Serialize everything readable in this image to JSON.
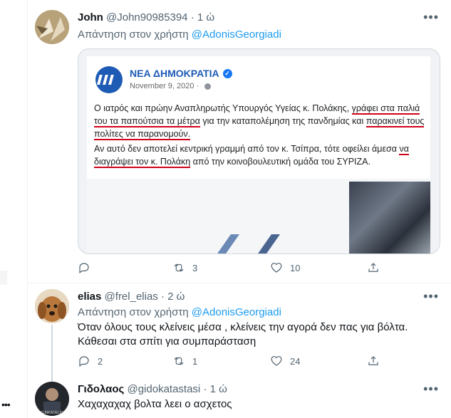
{
  "tweets": [
    {
      "name": "John",
      "handle": "@John90985394",
      "time": "· 1 ώ",
      "reply_prefix": "Απάντηση στον χρήστη",
      "reply_to": "@AdonisGeorgiadi",
      "embed": {
        "page_name": "ΝΕΑ ΔΗΜΟΚΡΑΤΙΑ",
        "date": "November 9, 2020 ·",
        "paragraph1_a": "Ο ιατρός και πρώην Αναπληρωτής Υπουργός Υγείας κ. Πολάκης, ",
        "paragraph1_u1": "γράφει στα παλιά του τα παπούτσια τα μέτρα",
        "paragraph1_b": " για την καταπολέμηση της πανδημίας και ",
        "paragraph1_u2": "παρακινεί τους πολίτες να παρανομούν.",
        "paragraph2_a": "Αν αυτό δεν αποτελεί κεντρική γραμμή από τον κ. Τσίπρα, τότε οφείλει άμεσα ",
        "paragraph2_u": "να διαγράψει τον κ. Πολάκη",
        "paragraph2_b": " από την κοινοβουλευτική ομάδα του ΣΥΡΙΖΑ."
      },
      "reply_count": "",
      "retweet_count": "3",
      "like_count": "10"
    },
    {
      "name": "elias",
      "handle": "@frel_elias",
      "time": "· 2 ώ",
      "reply_prefix": "Απάντηση στον χρήστη",
      "reply_to": "@AdonisGeorgiadi",
      "text": "Όταν όλους τους κλείνεις μέσα , κλείνεις την αγορά δεν πας για βόλτα. Κάθεσαι στα σπίτι για συμπαράσταση",
      "reply_count": "2",
      "retweet_count": "1",
      "like_count": "24"
    },
    {
      "name": "Γιδολαος",
      "handle": "@gidokatastasi",
      "time": "· 1 ώ",
      "text": "Χαχαχαχαχ βολτα λεει ο ασχετος",
      "avatar_caption": "FUNKADELIC"
    }
  ],
  "more_label": "•••",
  "left_more_label": "•••",
  "colors": {
    "accent": "#1d9bf0",
    "underline": "#d0021b",
    "nd_blue": "#1e5bb5"
  }
}
